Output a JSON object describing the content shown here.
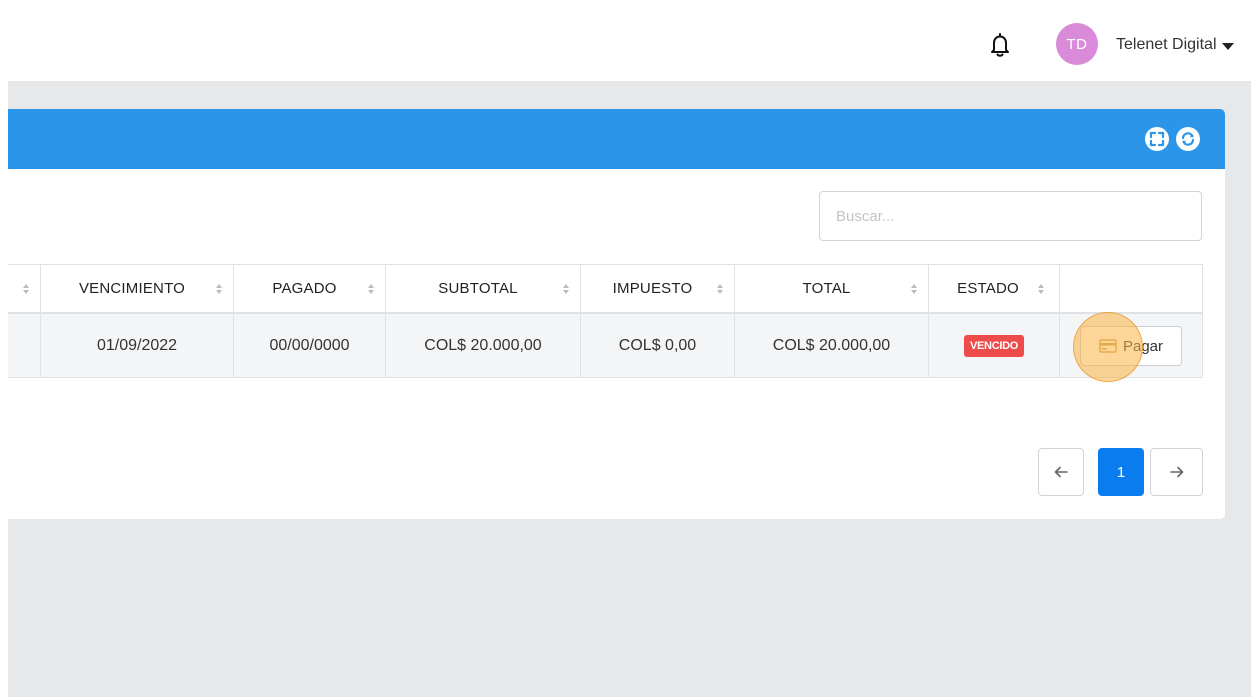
{
  "navbar": {
    "user_initials": "TD",
    "user_name": "Telenet Digital",
    "avatar_color": "#d98ad8"
  },
  "card": {
    "header_color": "#2b95ea",
    "icons": [
      "fullscreen-icon",
      "refresh-icon"
    ]
  },
  "search": {
    "placeholder": "Buscar..."
  },
  "table": {
    "columns": [
      "",
      "VENCIMIENTO",
      "PAGADO",
      "SUBTOTAL",
      "IMPUESTO",
      "TOTAL",
      "ESTADO",
      ""
    ],
    "rows": [
      {
        "vencimiento": "01/09/2022",
        "pagado": "00/00/0000",
        "subtotal": "COL$ 20.000,00",
        "impuesto": "COL$ 0,00",
        "total": "COL$ 20.000,00",
        "estado": "VENCIDO",
        "action_label": "Pagar"
      }
    ]
  },
  "pagination": {
    "current_page": "1",
    "prev_icon": "arrow-left-icon",
    "next_icon": "arrow-right-icon"
  },
  "colors": {
    "badge_danger": "#ee4b4b",
    "pagination_active": "#0b7cf0"
  }
}
